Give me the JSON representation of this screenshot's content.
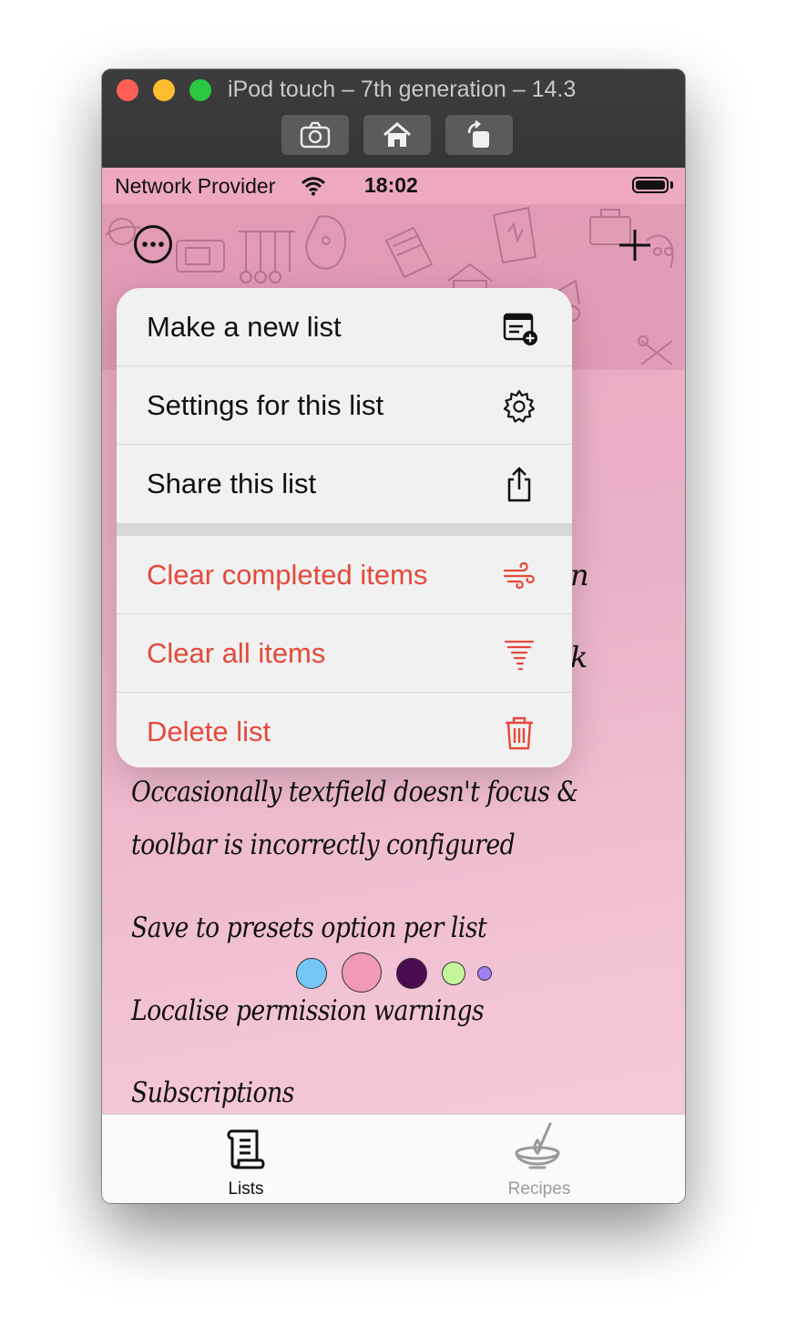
{
  "window": {
    "title": "iPod touch – 7th generation – 14.3",
    "toolbar": [
      {
        "name": "screenshot",
        "icon": "camera-icon"
      },
      {
        "name": "home",
        "icon": "home-icon"
      },
      {
        "name": "rotate",
        "icon": "rotate-icon"
      }
    ]
  },
  "status_bar": {
    "carrier": "Network Provider",
    "time": "18:02"
  },
  "nav": {
    "more_icon": "ellipsis-circle-icon",
    "add_icon": "plus-icon"
  },
  "menu": {
    "items": [
      {
        "label": "Make a new list",
        "icon": "new-list-icon",
        "destructive": false
      },
      {
        "label": "Settings for this list",
        "icon": "gear-icon",
        "destructive": false
      },
      {
        "label": "Share this list",
        "icon": "share-icon",
        "destructive": false
      },
      {
        "label": "Clear completed items",
        "icon": "wind-icon",
        "destructive": true
      },
      {
        "label": "Clear all items",
        "icon": "tornado-icon",
        "destructive": true
      },
      {
        "label": "Delete list",
        "icon": "trash-icon",
        "destructive": true
      }
    ],
    "destructive_color": "#e5493a"
  },
  "list": {
    "peek_texts": [
      "n",
      "k"
    ],
    "items": [
      "Occasionally textfield doesn't focus &",
      "toolbar is incorrectly configured",
      "Save to presets option per list",
      "Localise permission warnings",
      "Subscriptions"
    ]
  },
  "swatches": [
    {
      "color": "#74c6f7"
    },
    {
      "color": "#f19ab8"
    },
    {
      "color": "#4b0c4f"
    },
    {
      "color": "#c5f59a"
    },
    {
      "color": "#a07ef4"
    }
  ],
  "tabbar": {
    "tabs": [
      {
        "label": "Lists",
        "icon": "scroll-icon",
        "selected": true
      },
      {
        "label": "Recipes",
        "icon": "mixing-bowl-icon",
        "selected": false
      }
    ]
  },
  "colors": {
    "background": "#eea8c0",
    "tab_selected": "#111111",
    "tab_unselected": "#9a9a9a"
  }
}
